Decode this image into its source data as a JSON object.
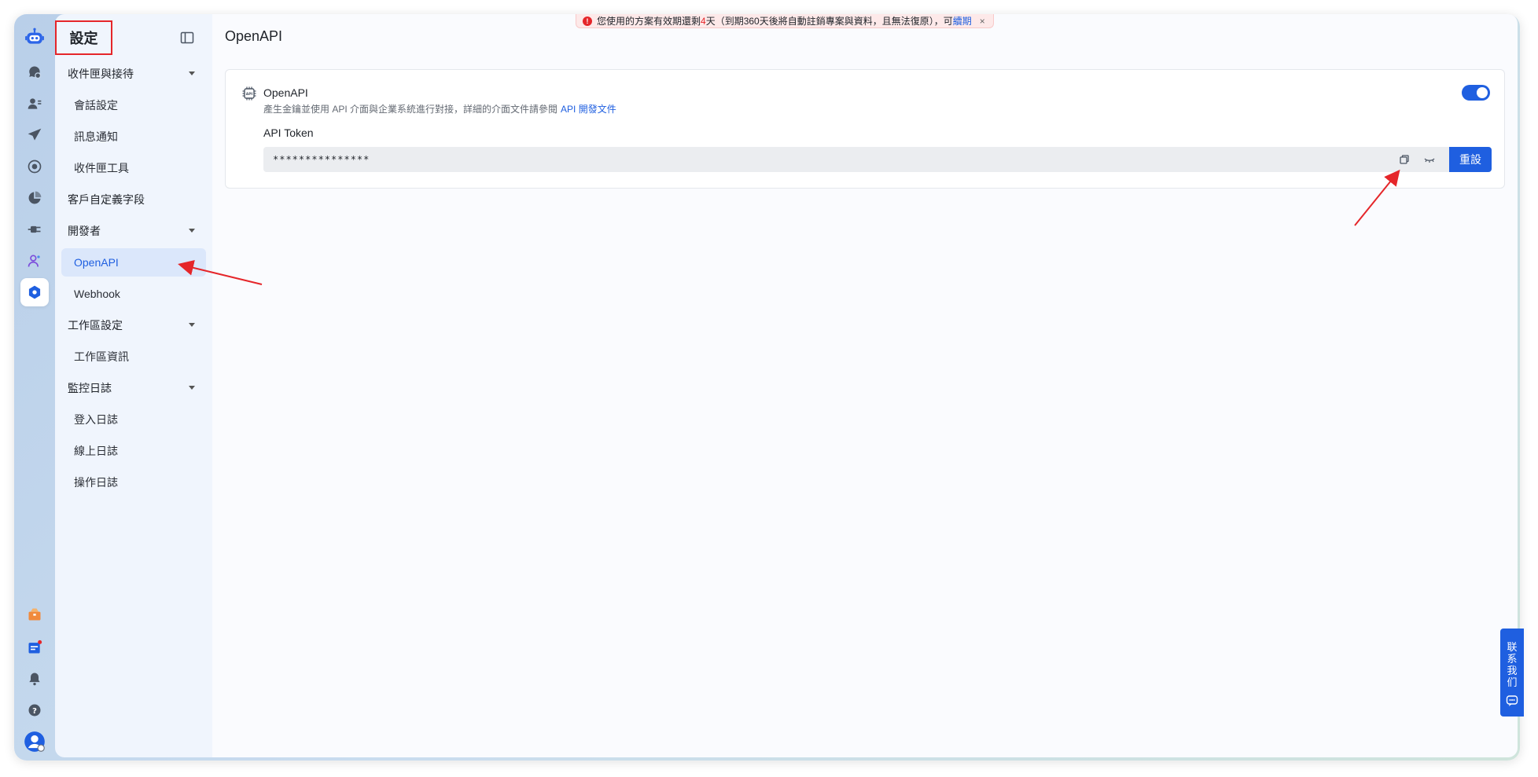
{
  "notice": {
    "text_before": "您使用的方案有效期還剩",
    "days": "4",
    "text_after": "天（到期360天後將自動註銷專案與資料，且無法復原），可",
    "link": "續期",
    "close": "×"
  },
  "sidebar": {
    "title": "設定",
    "groups": [
      {
        "label": "收件匣與接待",
        "items": [
          "會話設定",
          "訊息通知",
          "收件匣工具"
        ]
      },
      {
        "label": "客戶自定義字段",
        "items": []
      },
      {
        "label": "開發者",
        "items": [
          "OpenAPI",
          "Webhook"
        ]
      },
      {
        "label": "工作區設定",
        "items": [
          "工作區資訊"
        ]
      },
      {
        "label": "監控日誌",
        "items": [
          "登入日誌",
          "線上日誌",
          "操作日誌"
        ]
      }
    ]
  },
  "main": {
    "title": "OpenAPI",
    "card": {
      "title": "OpenAPI",
      "description": "產生金鑰並使用 API 介面與企業系統進行對接，詳細的介面文件請參閱",
      "doc_link": "API 開發文件",
      "token_label": "API Token",
      "token_value": "***************",
      "reset_label": "重設",
      "enabled": true
    }
  },
  "contact": {
    "chars": [
      "联",
      "系",
      "我",
      "们"
    ]
  },
  "colors": {
    "accent": "#1f5fe0",
    "warning": "#e5262a",
    "sidebar_bg": "#f0f5fd"
  },
  "icons": {
    "rail_top": [
      "bot-logo-icon",
      "chat-icon",
      "contacts-icon",
      "send-icon",
      "radar-icon",
      "pie-chart-icon",
      "plug-icon",
      "agent-icon",
      "settings-icon"
    ],
    "rail_bottom": [
      "package-icon",
      "calendar-icon",
      "bell-icon",
      "help-icon",
      "user-avatar-icon"
    ]
  }
}
